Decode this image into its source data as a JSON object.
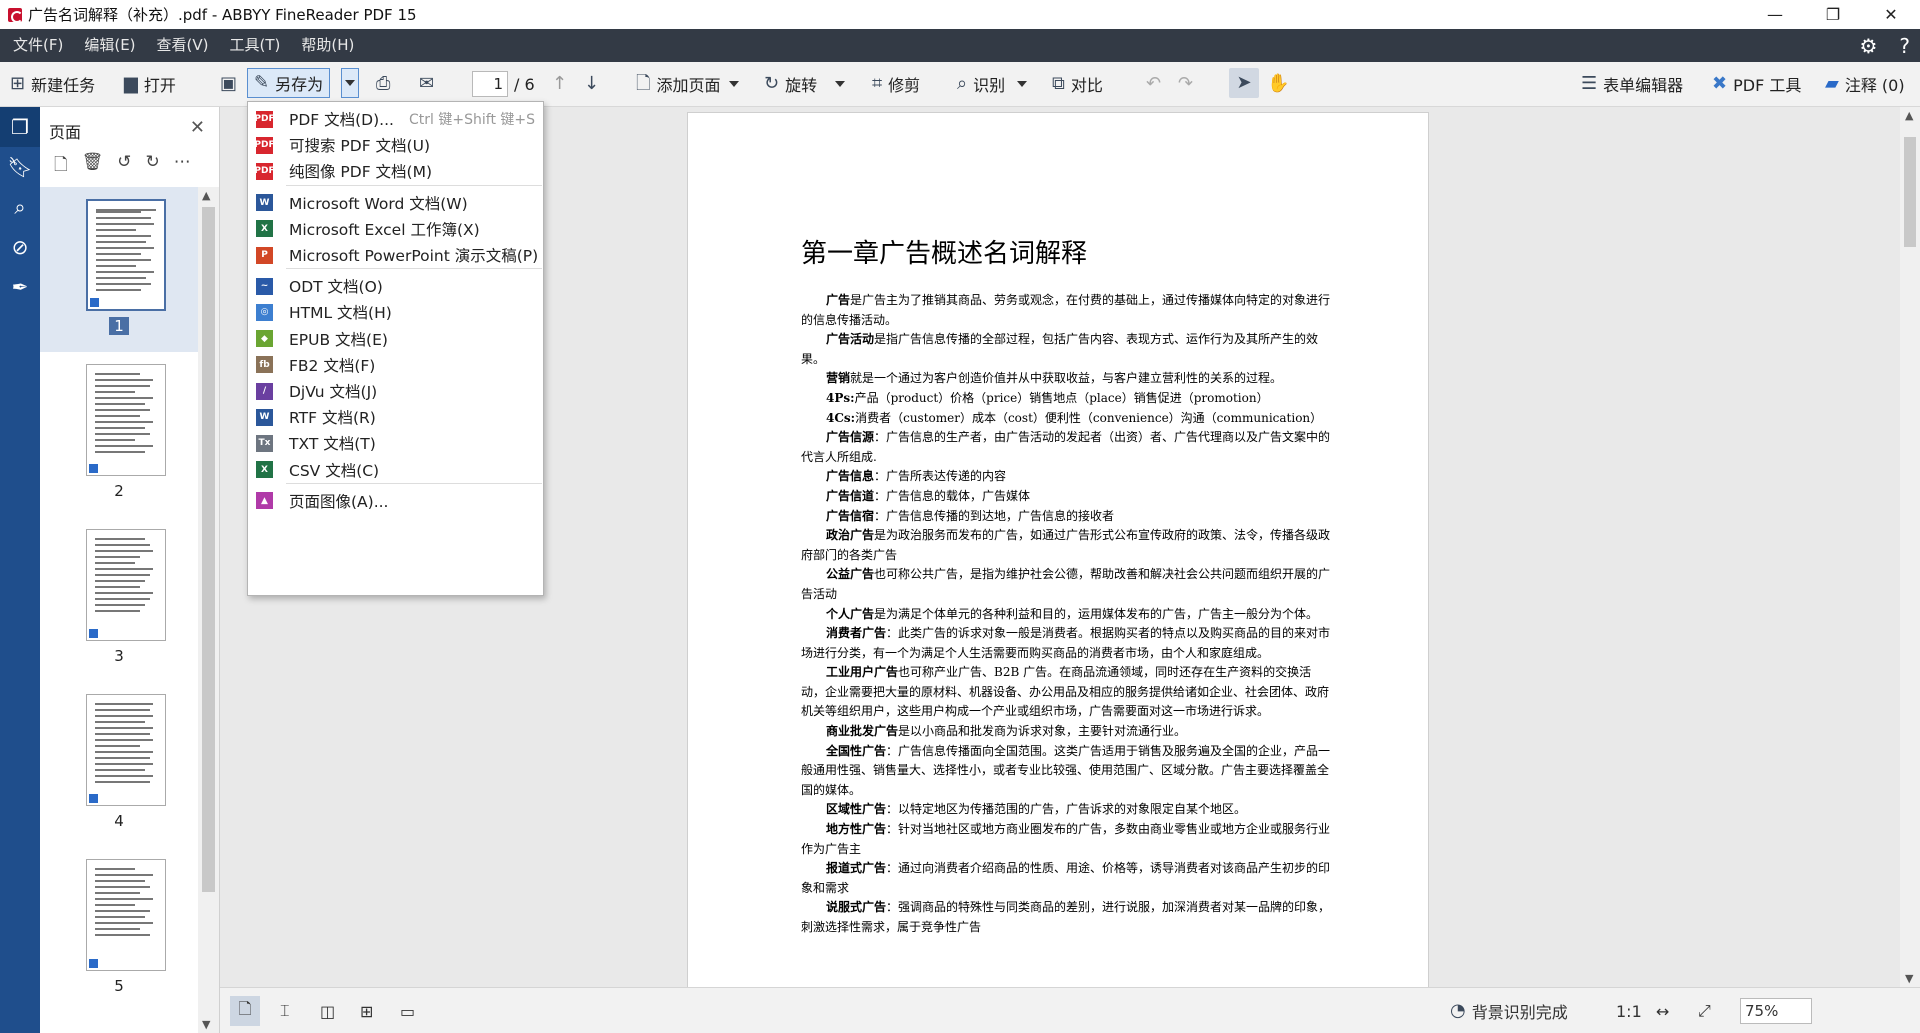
{
  "title_bar": {
    "title": "广告名词解释（补充）.pdf - ABBYY FineReader PDF 15"
  },
  "menubar": {
    "items": [
      "文件(F)",
      "编辑(E)",
      "查看(V)",
      "工具(T)",
      "帮助(H)"
    ]
  },
  "toolbar": {
    "new_task": "新建任务",
    "open": "打开",
    "save_as": "另存为",
    "page_current": "1",
    "page_total": "/ 6",
    "add_page": "添加页面",
    "rotate": "旋转",
    "crop": "修剪",
    "recognize": "识别",
    "compare": "对比",
    "form_editor": "表单编辑器",
    "pdf_tools": "PDF 工具",
    "comments": "注释 (0)"
  },
  "pages_panel": {
    "title": "页面",
    "pages": [
      "1",
      "2",
      "3",
      "4",
      "5"
    ],
    "selected": "1"
  },
  "save_as_menu": {
    "items": [
      {
        "label": "PDF 文档(D)...",
        "shortcut": "Ctrl 键+Shift 键+S",
        "icon": "pdf-icon",
        "color": "#d8262e",
        "glyph": "PDF"
      },
      {
        "label": "可搜索 PDF 文档(U)",
        "icon": "pdf-icon",
        "color": "#d8262e",
        "glyph": "PDF"
      },
      {
        "label": "纯图像 PDF 文档(M)",
        "icon": "pdf-icon",
        "color": "#d8262e",
        "glyph": "PDF"
      },
      {
        "label": "Microsoft Word 文档(W)",
        "icon": "word-icon",
        "color": "#2b579a",
        "glyph": "W"
      },
      {
        "label": "Microsoft Excel 工作簿(X)",
        "icon": "excel-icon",
        "color": "#217346",
        "glyph": "X"
      },
      {
        "label": "Microsoft PowerPoint 演示文稿(P)",
        "icon": "powerpoint-icon",
        "color": "#d24726",
        "glyph": "P"
      },
      {
        "label": "ODT 文档(O)",
        "icon": "odt-icon",
        "color": "#2a5aa8",
        "glyph": "~"
      },
      {
        "label": "HTML 文档(H)",
        "icon": "html-icon",
        "color": "#3d7fd0",
        "glyph": "◎"
      },
      {
        "label": "EPUB 文档(E)",
        "icon": "epub-icon",
        "color": "#6aa532",
        "glyph": "◆"
      },
      {
        "label": "FB2 文档(F)",
        "icon": "fb2-icon",
        "color": "#8a7258",
        "glyph": "fb"
      },
      {
        "label": "DjVu 文档(J)",
        "icon": "djvu-icon",
        "color": "#6a3fa0",
        "glyph": "/"
      },
      {
        "label": "RTF 文档(R)",
        "icon": "rtf-icon",
        "color": "#2b579a",
        "glyph": "W"
      },
      {
        "label": "TXT 文档(T)",
        "icon": "txt-icon",
        "color": "#6d7580",
        "glyph": "Tx"
      },
      {
        "label": "CSV 文档(C)",
        "icon": "csv-icon",
        "color": "#217346",
        "glyph": "X"
      },
      {
        "label": "页面图像(A)...",
        "icon": "image-icon",
        "color": "#b03aa8",
        "glyph": "▲"
      }
    ]
  },
  "document": {
    "title": "第一章广告概述名词解释",
    "paragraphs": [
      {
        "term": "广告",
        "text": "是广告主为了推销其商品、劳务或观念，在付费的基础上，通过传播媒体向特定的对象进行的信息传播活动。"
      },
      {
        "term": "广告活动",
        "text": "是指广告信息传播的全部过程，包括广告内容、表现方式、运作行为及其所产生的效果。"
      },
      {
        "term": "营销",
        "text": "就是一个通过为客户创造价值并从中获取收益，与客户建立营利性的关系的过程。"
      },
      {
        "term": "4Ps:",
        "text": "产品（product）价格（price）销售地点（place）销售促进（promotion）"
      },
      {
        "term": "4Cs:",
        "text": "消费者（customer）成本（cost）便利性（convenience）沟通（communication）"
      },
      {
        "term": "广告信源",
        "text": "：广告信息的生产者，由广告活动的发起者（出资）者、广告代理商以及广告文案中的代言人所组成."
      },
      {
        "term": "广告信息",
        "text": "：广告所表达传递的内容"
      },
      {
        "term": "广告信道",
        "text": "：广告信息的载体，广告媒体"
      },
      {
        "term": "广告信宿",
        "text": "：广告信息传播的到达地，广告信息的接收者"
      },
      {
        "term": "政治广告",
        "text": "是为政治服务而发布的广告，如通过广告形式公布宣传政府的政策、法令，传播各级政府部门的各类广告"
      },
      {
        "term": "公益广告",
        "text": "也可称公共广告，是指为维护社会公德，帮助改善和解决社会公共问题而组织开展的广告活动"
      },
      {
        "term": "个人广告",
        "text": "是为满足个体单元的各种利益和目的，运用媒体发布的广告，广告主一般分为个体。"
      },
      {
        "term": "消费者广告",
        "text": "：此类广告的诉求对象一般是消费者。根据购买者的特点以及购买商品的目的来对市场进行分类，有一个为满足个人生活需要而购买商品的消费者市场，由个人和家庭组成。"
      },
      {
        "term": "工业用户广告",
        "text": "也可称产业广告、B2B 广告。在商品流通领域，同时还存在生产资料的交换活动，企业需要把大量的原材料、机器设备、办公用品及相应的服务提供给诸如企业、社会团体、政府机关等组织用户，这些用户构成一个产业或组织市场，广告需要面对这一市场进行诉求。"
      },
      {
        "term": "商业批发广告",
        "text": "是以小商品和批发商为诉求对象，主要针对流通行业。"
      },
      {
        "term": "全国性广告",
        "text": "：广告信息传播面向全国范围。这类广告适用于销售及服务遍及全国的企业，产品一般通用性强、销售量大、选择性小，或者专业比较强、使用范围广、区域分散。广告主要选择覆盖全国的媒体。"
      },
      {
        "term": "区域性广告",
        "text": "：以特定地区为传播范围的广告，广告诉求的对象限定自某个地区。"
      },
      {
        "term": "地方性广告",
        "text": "：针对当地社区或地方商业圈发布的广告，多数由商业零售业或地方企业或服务行业作为广告主"
      },
      {
        "term": "报道式广告",
        "text": "：通过向消费者介绍商品的性质、用途、价格等，诱导消费者对该商品产生初步的印象和需求"
      },
      {
        "term": "说服式广告",
        "text": "：强调商品的特殊性与同类商品的差别，进行说服，加深消费者对某一品牌的印象，刺激选择性需求，属于竞争性广告"
      }
    ]
  },
  "statusbar": {
    "recognition_status": "背景识别完成",
    "ratio": "1:1",
    "zoom": "75%"
  }
}
